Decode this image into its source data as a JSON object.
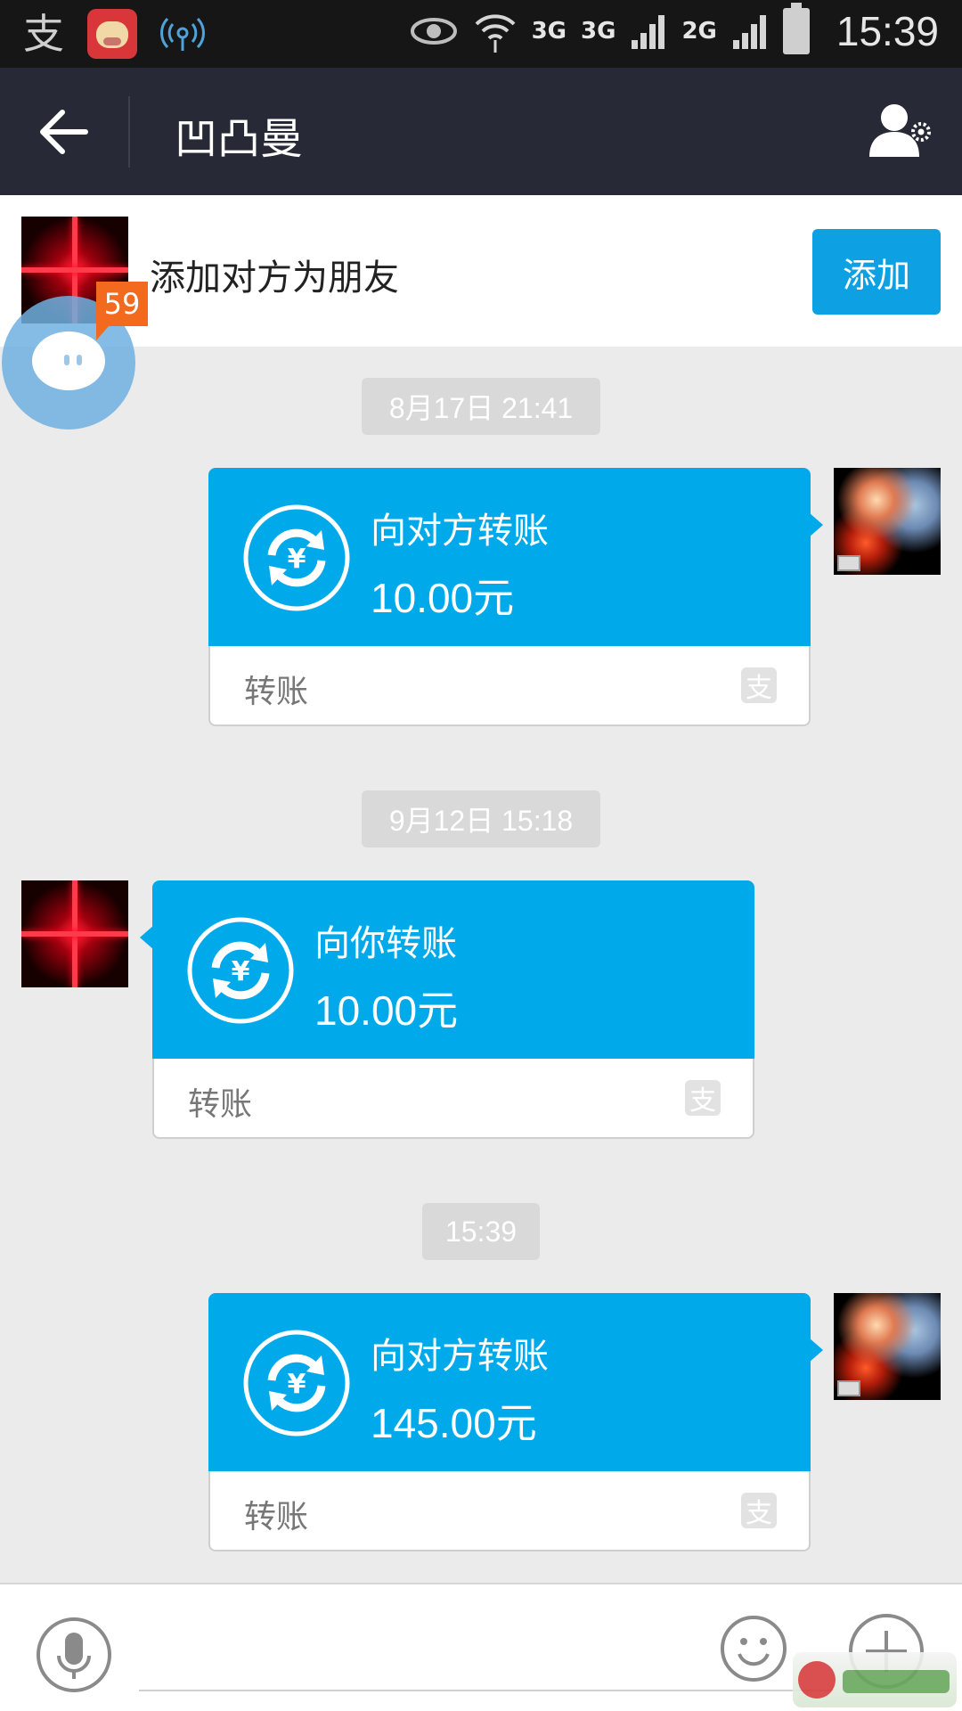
{
  "status_bar": {
    "network_1": "3G",
    "network_2": "3G",
    "network_3": "2G",
    "time": "15:39"
  },
  "header": {
    "title": "凹凸曼"
  },
  "add_friend_banner": {
    "text": "添加对方为朋友",
    "button_label": "添加",
    "unread_badge": "59"
  },
  "messages": [
    {
      "timestamp": "8月17日 21:41",
      "direction": "outgoing",
      "title": "向对方转账",
      "amount": "10.00元",
      "footer_label": "转账"
    },
    {
      "timestamp": "9月12日 15:18",
      "direction": "incoming",
      "title": "向你转账",
      "amount": "10.00元",
      "footer_label": "转账"
    },
    {
      "timestamp": "15:39",
      "direction": "outgoing",
      "title": "向对方转账",
      "amount": "145.00元",
      "footer_label": "转账"
    }
  ],
  "icons": {
    "back": "arrow-left-icon",
    "profile_settings": "user-gear-icon",
    "transfer": "yuan-circle-arrows-icon",
    "alipay_logo": "alipay-icon",
    "microphone": "microphone-icon",
    "emoji": "smile-icon",
    "more": "plus-icon"
  },
  "colors": {
    "title_bar": "#272a36",
    "transfer_blue": "#00aaea",
    "add_button": "#0da1e4",
    "badge": "#f36a1f",
    "background": "#ebebeb"
  }
}
